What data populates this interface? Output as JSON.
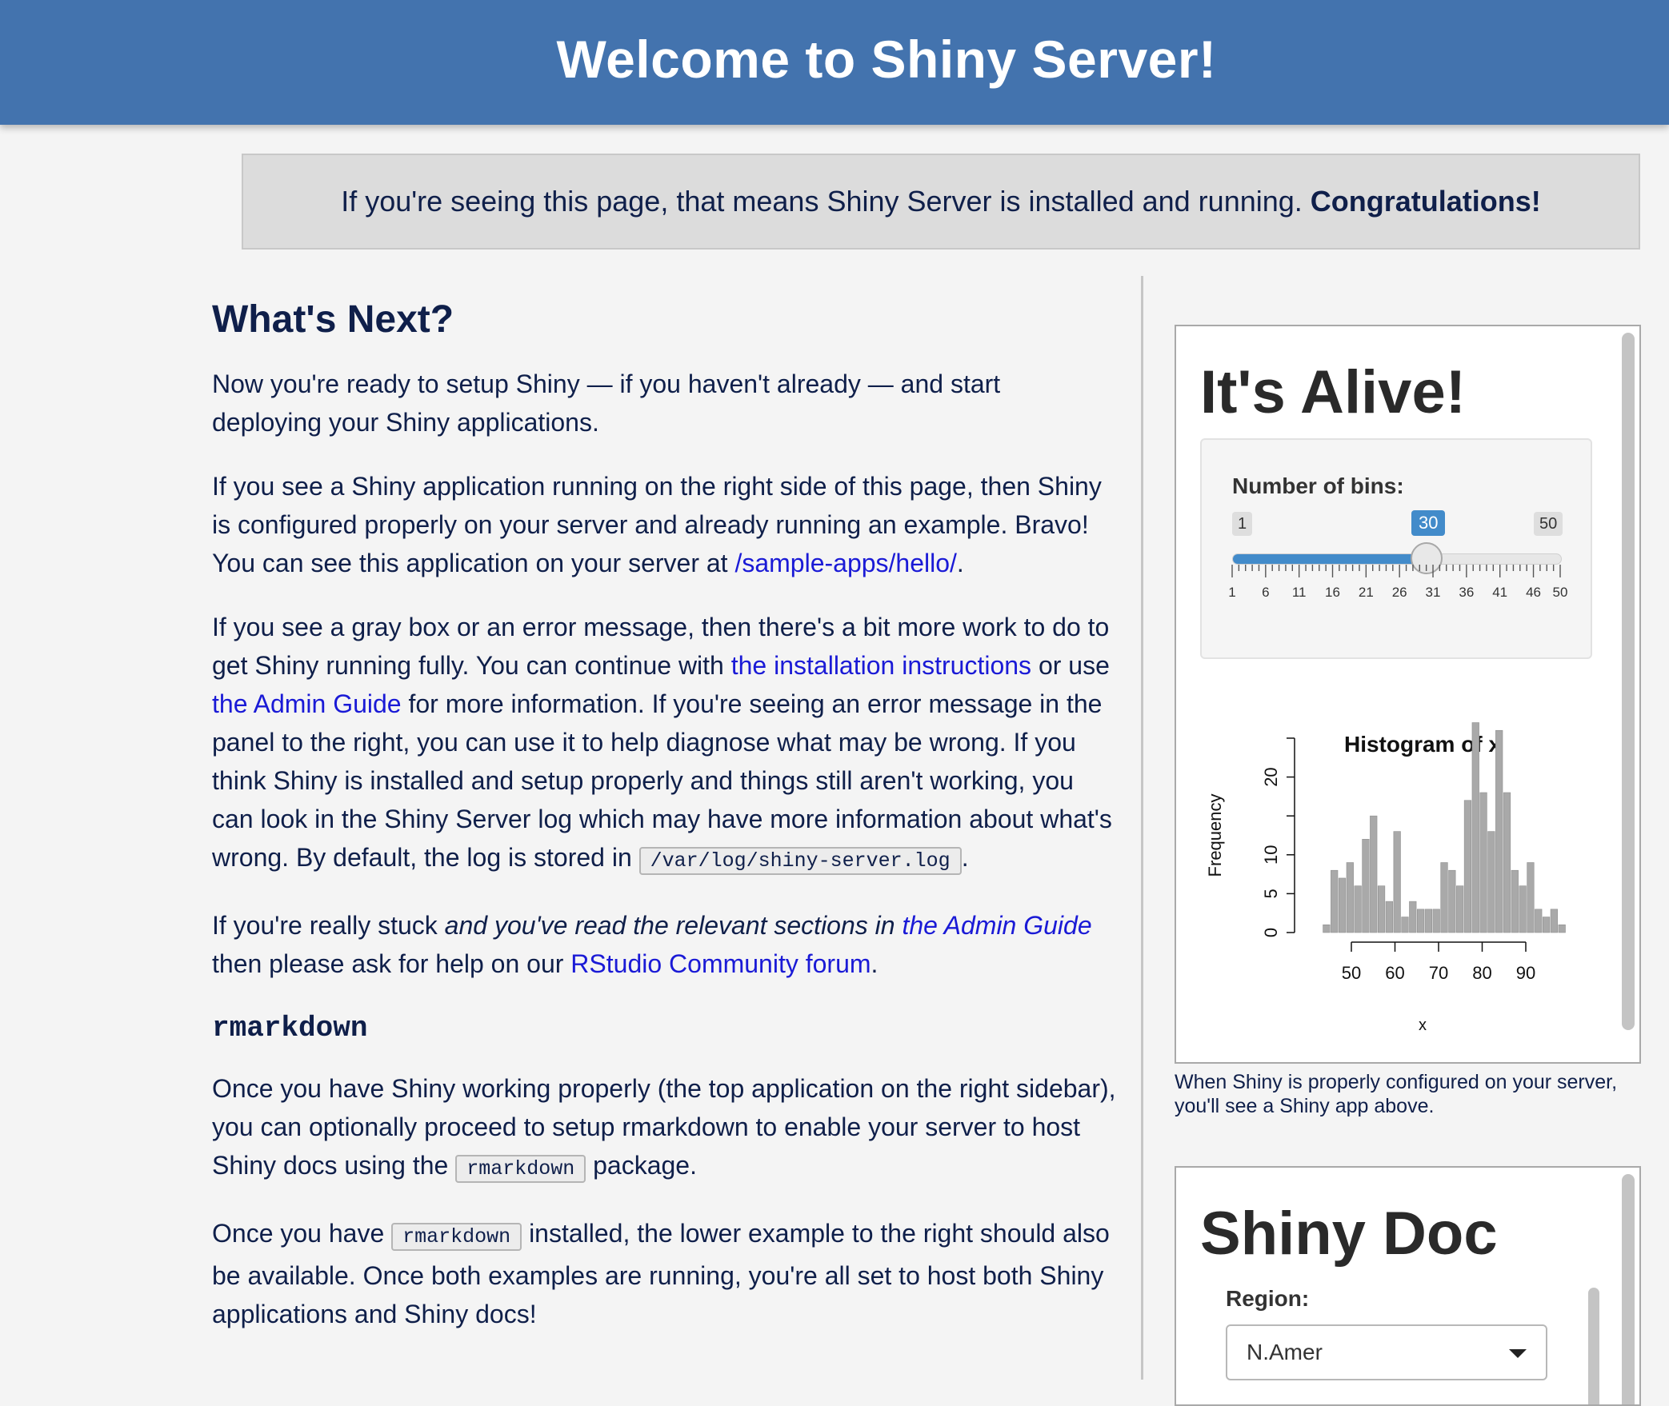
{
  "header": {
    "title": "Welcome to Shiny Server!"
  },
  "banner": {
    "text": "If you're seeing this page, that means Shiny Server is installed and running.",
    "emphasis": "Congratulations!"
  },
  "main": {
    "heading": "What's Next?",
    "p1": "Now you're ready to setup Shiny — if you haven't already — and start deploying your Shiny applications.",
    "p2_text": "If you see a Shiny application running on the right side of this page, then Shiny is configured properly on your server and already running an example. Bravo! You can see this application on your server at",
    "p2_link": "/sample-apps/hello/",
    "p3_a": "If you see a gray box or an error message, then there's a bit more work to do to get Shiny running fully. You can continue with",
    "p3_link1": "the installation instructions",
    "p3_b": "or use",
    "p3_link2": "the Admin Guide",
    "p3_c": "for more information. If you're seeing an error message in the panel to the right, you can use it to help diagnose what may be wrong. If you think Shiny is installed and setup properly and things still aren't working, you can look in the Shiny Server log which may have more information about what's wrong. By default, the log is stored in",
    "p3_code": "/var/log/shiny-server.log",
    "p4_a": "If you're really stuck",
    "p4_em": "and you've read the relevant sections in",
    "p4_link1": "the Admin Guide",
    "p4_b": "then please ask for help on our",
    "p4_link2": "RStudio Community forum",
    "rmd_heading": "rmarkdown",
    "p5_a": "Once you have Shiny working properly (the top application on the right sidebar), you can optionally proceed to setup rmarkdown to enable your server to host Shiny docs using the",
    "p5_code": "rmarkdown",
    "p5_b": "package.",
    "p6_a": "Once you have",
    "p6_code": "rmarkdown",
    "p6_b": "installed, the lower example to the right should also be available. Once both examples are running, you're all set to host both Shiny applications and Shiny docs!"
  },
  "app1": {
    "title": "It's Alive!",
    "slider": {
      "label": "Number of bins:",
      "min": 1,
      "max": 50,
      "value": 30,
      "ticks": [
        "1",
        "6",
        "11",
        "16",
        "21",
        "26",
        "31",
        "36",
        "41",
        "46",
        "50"
      ]
    },
    "caption": "When Shiny is properly configured on your server, you'll see a Shiny app above."
  },
  "app2": {
    "title": "Shiny Doc",
    "region_label": "Region:",
    "region_value": "N.Amer"
  },
  "chart_data": {
    "type": "bar",
    "title": "Histogram of x",
    "xlabel": "x",
    "ylabel": "Frequency",
    "x_ticks": [
      50,
      60,
      70,
      80,
      90
    ],
    "y_ticks": [
      0,
      5,
      10,
      20
    ],
    "xlim": [
      42,
      97
    ],
    "ylim": [
      0,
      25
    ],
    "bin_start": 43.5,
    "bin_width": 1.8,
    "values": [
      1,
      8,
      7,
      9,
      6,
      12,
      15,
      6,
      4,
      13,
      2,
      4,
      3,
      3,
      3,
      9,
      8,
      6,
      17,
      27,
      18,
      13,
      26,
      18,
      8,
      6,
      9,
      3,
      2,
      3,
      1
    ]
  }
}
